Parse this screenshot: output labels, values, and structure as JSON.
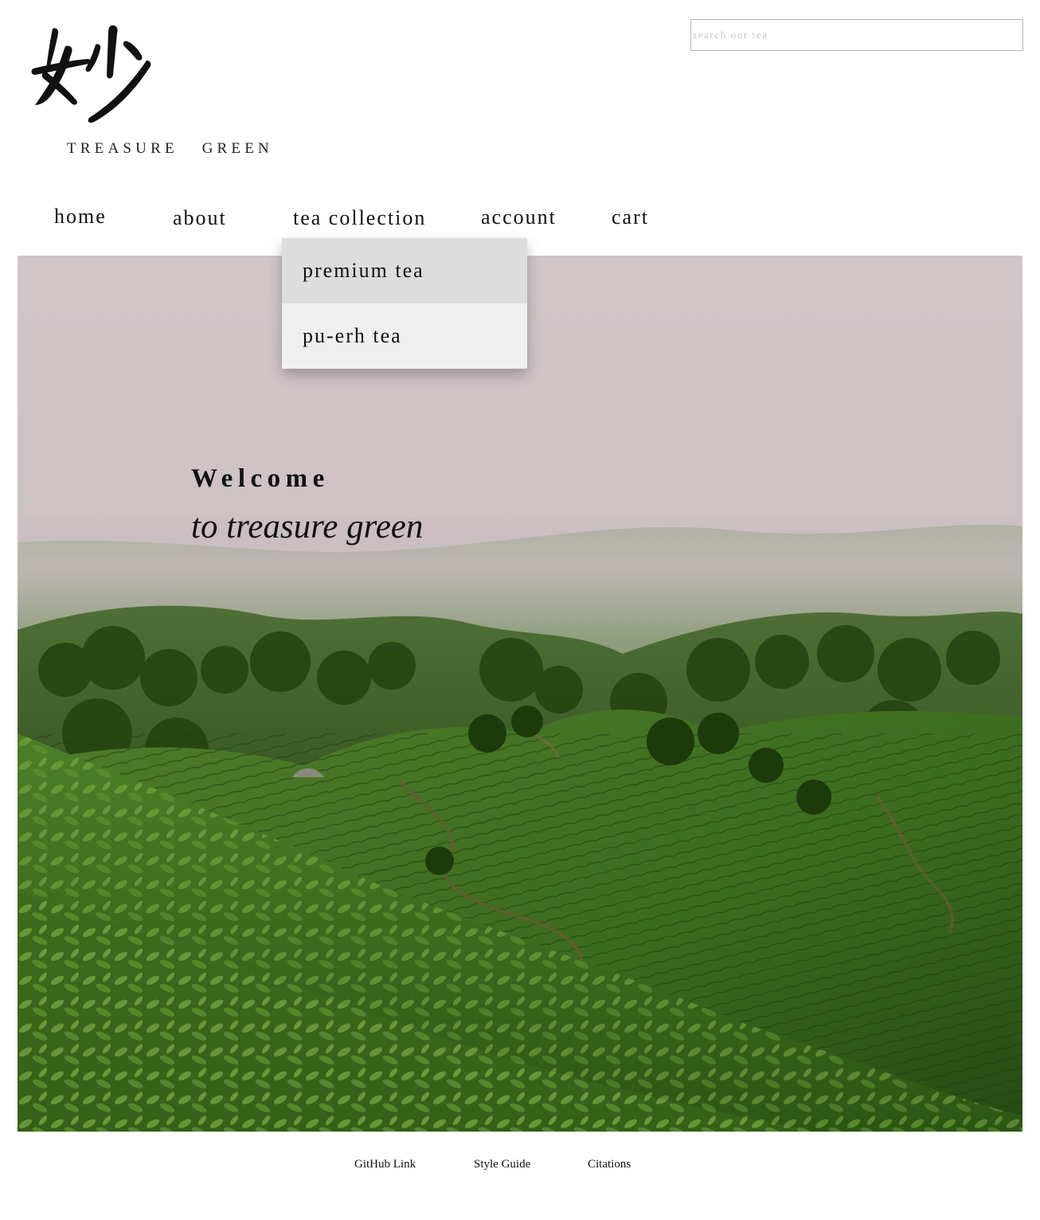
{
  "brand": {
    "name": "TREASURE   GREEN",
    "mark_char": "妙"
  },
  "search": {
    "placeholder": "search our tea",
    "value": ""
  },
  "nav": {
    "home": "home",
    "about": "about",
    "tea_collection": "tea collection",
    "account": "account",
    "cart": "cart"
  },
  "dropdown": {
    "items": [
      "premium tea",
      "pu-erh tea"
    ],
    "hovered_index": 0
  },
  "hero": {
    "welcome": "Welcome",
    "subtitle": "to treasure green",
    "image_description_colors": {
      "fog": "#cbbfc2",
      "hill_light": "#5f8a3a",
      "hill_dark": "#234a15",
      "foreground": "#3f6e23"
    }
  },
  "footer": {
    "github": "GitHub Link",
    "style_guide": "Style Guide",
    "citations": "Citations"
  },
  "colors": {
    "background": "#ffffff",
    "text": "#111111",
    "dropdown_bg": "#efefef",
    "dropdown_hover": "#dddddd",
    "search_border": "#b5b5b5"
  }
}
